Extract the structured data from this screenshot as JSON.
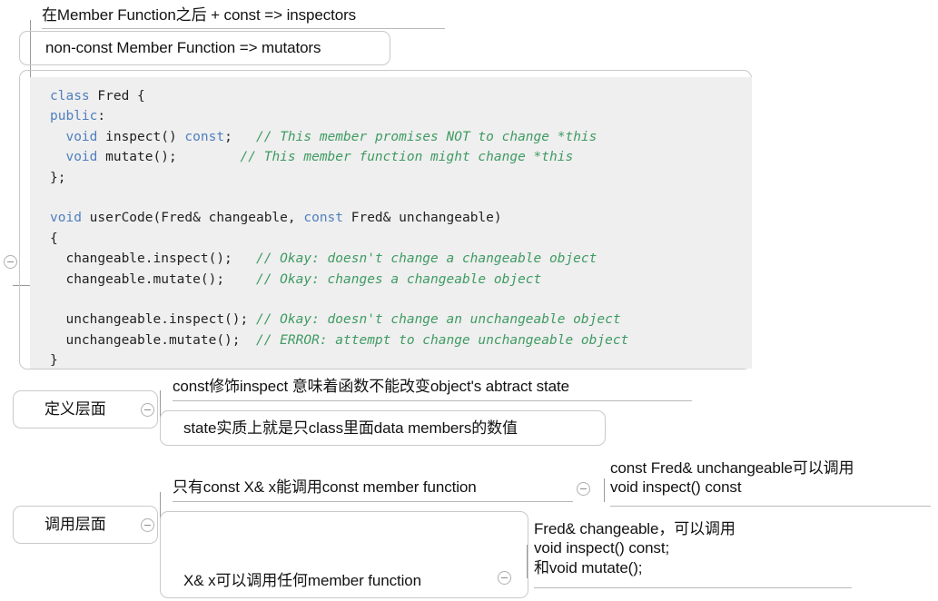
{
  "diagram": {
    "type": "mindmap",
    "title_note": "C++ const member function mind map",
    "accent_line_color": "#9a9a9a",
    "node_border_color": "#c9c9c9",
    "code_background": "#efefef",
    "code_keyword_color": "#4f7fbf",
    "code_comment_color": "#3f9b63"
  },
  "nodes": {
    "inspectors": {
      "label": "在Member Function之后 + const => inspectors"
    },
    "mutators": {
      "label": "non-const Member Function => mutators"
    },
    "definition_level": {
      "label": "定义层面"
    },
    "definition_child_1": {
      "label": "const修饰inspect 意味着函数不能改变object's abtract state"
    },
    "definition_child_2": {
      "label": "state实质上就是只class里面data members的数值"
    },
    "invocation_level": {
      "label": "调用层面"
    },
    "invocation_child_1": {
      "label": "只有const X& x能调用const member function"
    },
    "invocation_child_1_detail": {
      "line1": "const Fred& unchangeable可以调用",
      "line2": "void inspect() const"
    },
    "invocation_child_2": {
      "label": "X& x可以调用任何member function"
    },
    "invocation_child_2_detail": {
      "line1": "Fred& changeable，可以调用",
      "line2": "void inspect() const;",
      "line3": "和void mutate();"
    }
  },
  "code": {
    "language": "cpp",
    "lines": [
      {
        "segments": [
          {
            "t": "class ",
            "c": "kw"
          },
          {
            "t": "Fred {",
            "c": "pl"
          }
        ]
      },
      {
        "segments": [
          {
            "t": "public",
            "c": "kw"
          },
          {
            "t": ":",
            "c": "pl"
          }
        ]
      },
      {
        "segments": [
          {
            "t": "  ",
            "c": "pl"
          },
          {
            "t": "void",
            "c": "kw"
          },
          {
            "t": " inspect() ",
            "c": "pl"
          },
          {
            "t": "const",
            "c": "kw"
          },
          {
            "t": ";   ",
            "c": "pl"
          },
          {
            "t": "// This member promises NOT to change *this",
            "c": "cm"
          }
        ]
      },
      {
        "segments": [
          {
            "t": "  ",
            "c": "pl"
          },
          {
            "t": "void",
            "c": "kw"
          },
          {
            "t": " mutate();        ",
            "c": "pl"
          },
          {
            "t": "// This member function might change *this",
            "c": "cm"
          }
        ]
      },
      {
        "segments": [
          {
            "t": "};",
            "c": "pl"
          }
        ]
      },
      {
        "segments": [
          {
            "t": "",
            "c": "pl"
          }
        ]
      },
      {
        "segments": [
          {
            "t": "void",
            "c": "kw"
          },
          {
            "t": " userCode(Fred& changeable, ",
            "c": "pl"
          },
          {
            "t": "const",
            "c": "kw"
          },
          {
            "t": " Fred& unchangeable)",
            "c": "pl"
          }
        ]
      },
      {
        "segments": [
          {
            "t": "{",
            "c": "pl"
          }
        ]
      },
      {
        "segments": [
          {
            "t": "  changeable.inspect();   ",
            "c": "pl"
          },
          {
            "t": "// Okay: doesn't change a changeable object",
            "c": "cm"
          }
        ]
      },
      {
        "segments": [
          {
            "t": "  changeable.mutate();    ",
            "c": "pl"
          },
          {
            "t": "// Okay: changes a changeable object",
            "c": "cm"
          }
        ]
      },
      {
        "segments": [
          {
            "t": "",
            "c": "pl"
          }
        ]
      },
      {
        "segments": [
          {
            "t": "  unchangeable.inspect(); ",
            "c": "pl"
          },
          {
            "t": "// Okay: doesn't change an unchangeable object",
            "c": "cm"
          }
        ]
      },
      {
        "segments": [
          {
            "t": "  unchangeable.mutate();  ",
            "c": "pl"
          },
          {
            "t": "// ERROR: attempt to change unchangeable object",
            "c": "cm"
          }
        ]
      },
      {
        "segments": [
          {
            "t": "}",
            "c": "pl"
          }
        ]
      }
    ]
  }
}
